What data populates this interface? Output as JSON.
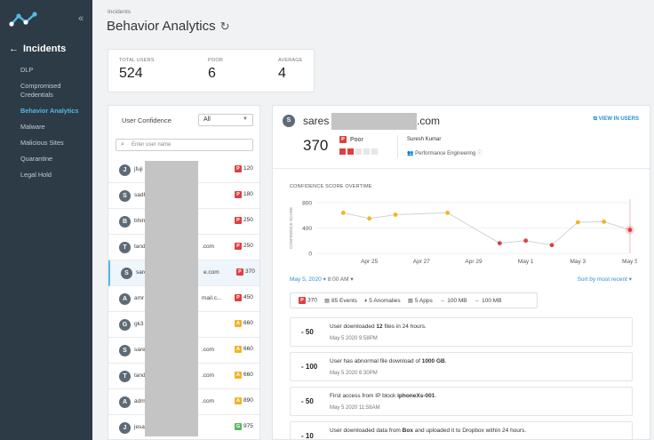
{
  "colors": {
    "sidebar_bg": "#2c3b46",
    "accent": "#52b9e6",
    "poor": "#e03e3e",
    "average": "#f2b325",
    "good": "#5cb85c",
    "link": "#2d8fd6"
  },
  "sidebar": {
    "back_label": "Incidents",
    "items": [
      {
        "label": "DLP",
        "active": false
      },
      {
        "label": "Compromised Credentials",
        "active": false
      },
      {
        "label": "Behavior Analytics",
        "active": true
      },
      {
        "label": "Malware",
        "active": false
      },
      {
        "label": "Malicious Sites",
        "active": false
      },
      {
        "label": "Quarantine",
        "active": false
      },
      {
        "label": "Legal Hold",
        "active": false
      }
    ]
  },
  "header": {
    "breadcrumb": "Incidents",
    "title": "Behavior Analytics"
  },
  "stats": [
    {
      "label": "TOTAL USERS",
      "value": "524"
    },
    {
      "label": "POOR",
      "value": "6"
    },
    {
      "label": "AVERAGE",
      "value": "4"
    }
  ],
  "user_panel": {
    "heading": "User Confidence",
    "filter_value": "All",
    "search_placeholder": "Enter user name",
    "users": [
      {
        "initial": "J",
        "name": "jfuji",
        "tail": "",
        "rating": "P",
        "score": "120"
      },
      {
        "initial": "S",
        "name": "sadh",
        "tail": "",
        "rating": "P",
        "score": "180"
      },
      {
        "initial": "B",
        "name": "bhin",
        "tail": "",
        "rating": "P",
        "score": "250"
      },
      {
        "initial": "T",
        "name": "tand",
        "tail": ".com",
        "rating": "P",
        "score": "250"
      },
      {
        "initial": "S",
        "name": "sare",
        "tail": "e.com",
        "rating": "P",
        "score": "370",
        "selected": true
      },
      {
        "initial": "A",
        "name": "amr",
        "tail": "mail.c...",
        "rating": "P",
        "score": "450"
      },
      {
        "initial": "G",
        "name": "gk3",
        "tail": "",
        "rating": "A",
        "score": "660"
      },
      {
        "initial": "S",
        "name": "sare",
        "tail": ".com",
        "rating": "A",
        "score": "660"
      },
      {
        "initial": "T",
        "name": "tand",
        "tail": ".com",
        "rating": "A",
        "score": "660"
      },
      {
        "initial": "A",
        "name": "adm",
        "tail": ".com",
        "rating": "A",
        "score": "890"
      },
      {
        "initial": "J",
        "name": "jesa",
        "tail": "",
        "rating": "G",
        "score": "975"
      }
    ]
  },
  "detail": {
    "avatar_initial": "S",
    "email_start": "sares",
    "email_end": ".com",
    "view_link": "VIEW IN USERS",
    "score": "370",
    "rating_badge": "P",
    "rating_label": "Poor",
    "rating_level": 2,
    "manager": "Suresh Kumar",
    "department": "Performance Engineering",
    "chart_title": "CONFIDENCE SCORE OVERTIME",
    "date_filter": "May 5, 2020",
    "time_filter": "8:00 AM",
    "sort_label": "Sort by most recent",
    "summary": {
      "score_badge": "P",
      "score": "370",
      "events": "85 Events",
      "anomalies": "5 Anomalies",
      "apps": "5 Apps",
      "upload": "100 MB",
      "download": "100 MB"
    },
    "events": [
      {
        "delta": "- 50",
        "pre": "User downloaded ",
        "bold": "12",
        "post": " files in 24 hours.",
        "time": "May 5 2020 9:58PM"
      },
      {
        "delta": "- 100",
        "pre": "User has abnormal file download of ",
        "bold": "1000 GB",
        "post": ".",
        "time": "May 5 2020 6:30PM"
      },
      {
        "delta": "- 50",
        "pre": "First access from IP block ",
        "bold": "iphoneXs-001",
        "post": ".",
        "time": "May 5 2020 11:58AM"
      },
      {
        "delta": "- 10",
        "pre": "User downloaded data from ",
        "bold": "Box",
        "post": " and uploaded it to Dropbox within 24 hours.",
        "time": ""
      }
    ]
  },
  "chart_data": {
    "type": "line",
    "title": "CONFIDENCE SCORE OVERTIME",
    "ylabel": "CONFIDENCE SCORE",
    "ylim": [
      0,
      800
    ],
    "yticks": [
      "800",
      "400",
      "0"
    ],
    "xticks": [
      "Apr 25",
      "Apr 27",
      "Apr 29",
      "May 1",
      "May 3",
      "May 5"
    ],
    "points": [
      {
        "x": "Apr 24",
        "y": 640,
        "rating": "average"
      },
      {
        "x": "Apr 25",
        "y": 550,
        "rating": "average"
      },
      {
        "x": "Apr 26",
        "y": 610,
        "rating": "average"
      },
      {
        "x": "Apr 28",
        "y": 640,
        "rating": "average"
      },
      {
        "x": "Apr 30",
        "y": 160,
        "rating": "poor"
      },
      {
        "x": "May 1",
        "y": 200,
        "rating": "poor"
      },
      {
        "x": "May 2",
        "y": 130,
        "rating": "poor"
      },
      {
        "x": "May 3",
        "y": 490,
        "rating": "average"
      },
      {
        "x": "May 4",
        "y": 500,
        "rating": "average"
      },
      {
        "x": "May 5",
        "y": 370,
        "rating": "poor",
        "selected": true
      }
    ]
  }
}
